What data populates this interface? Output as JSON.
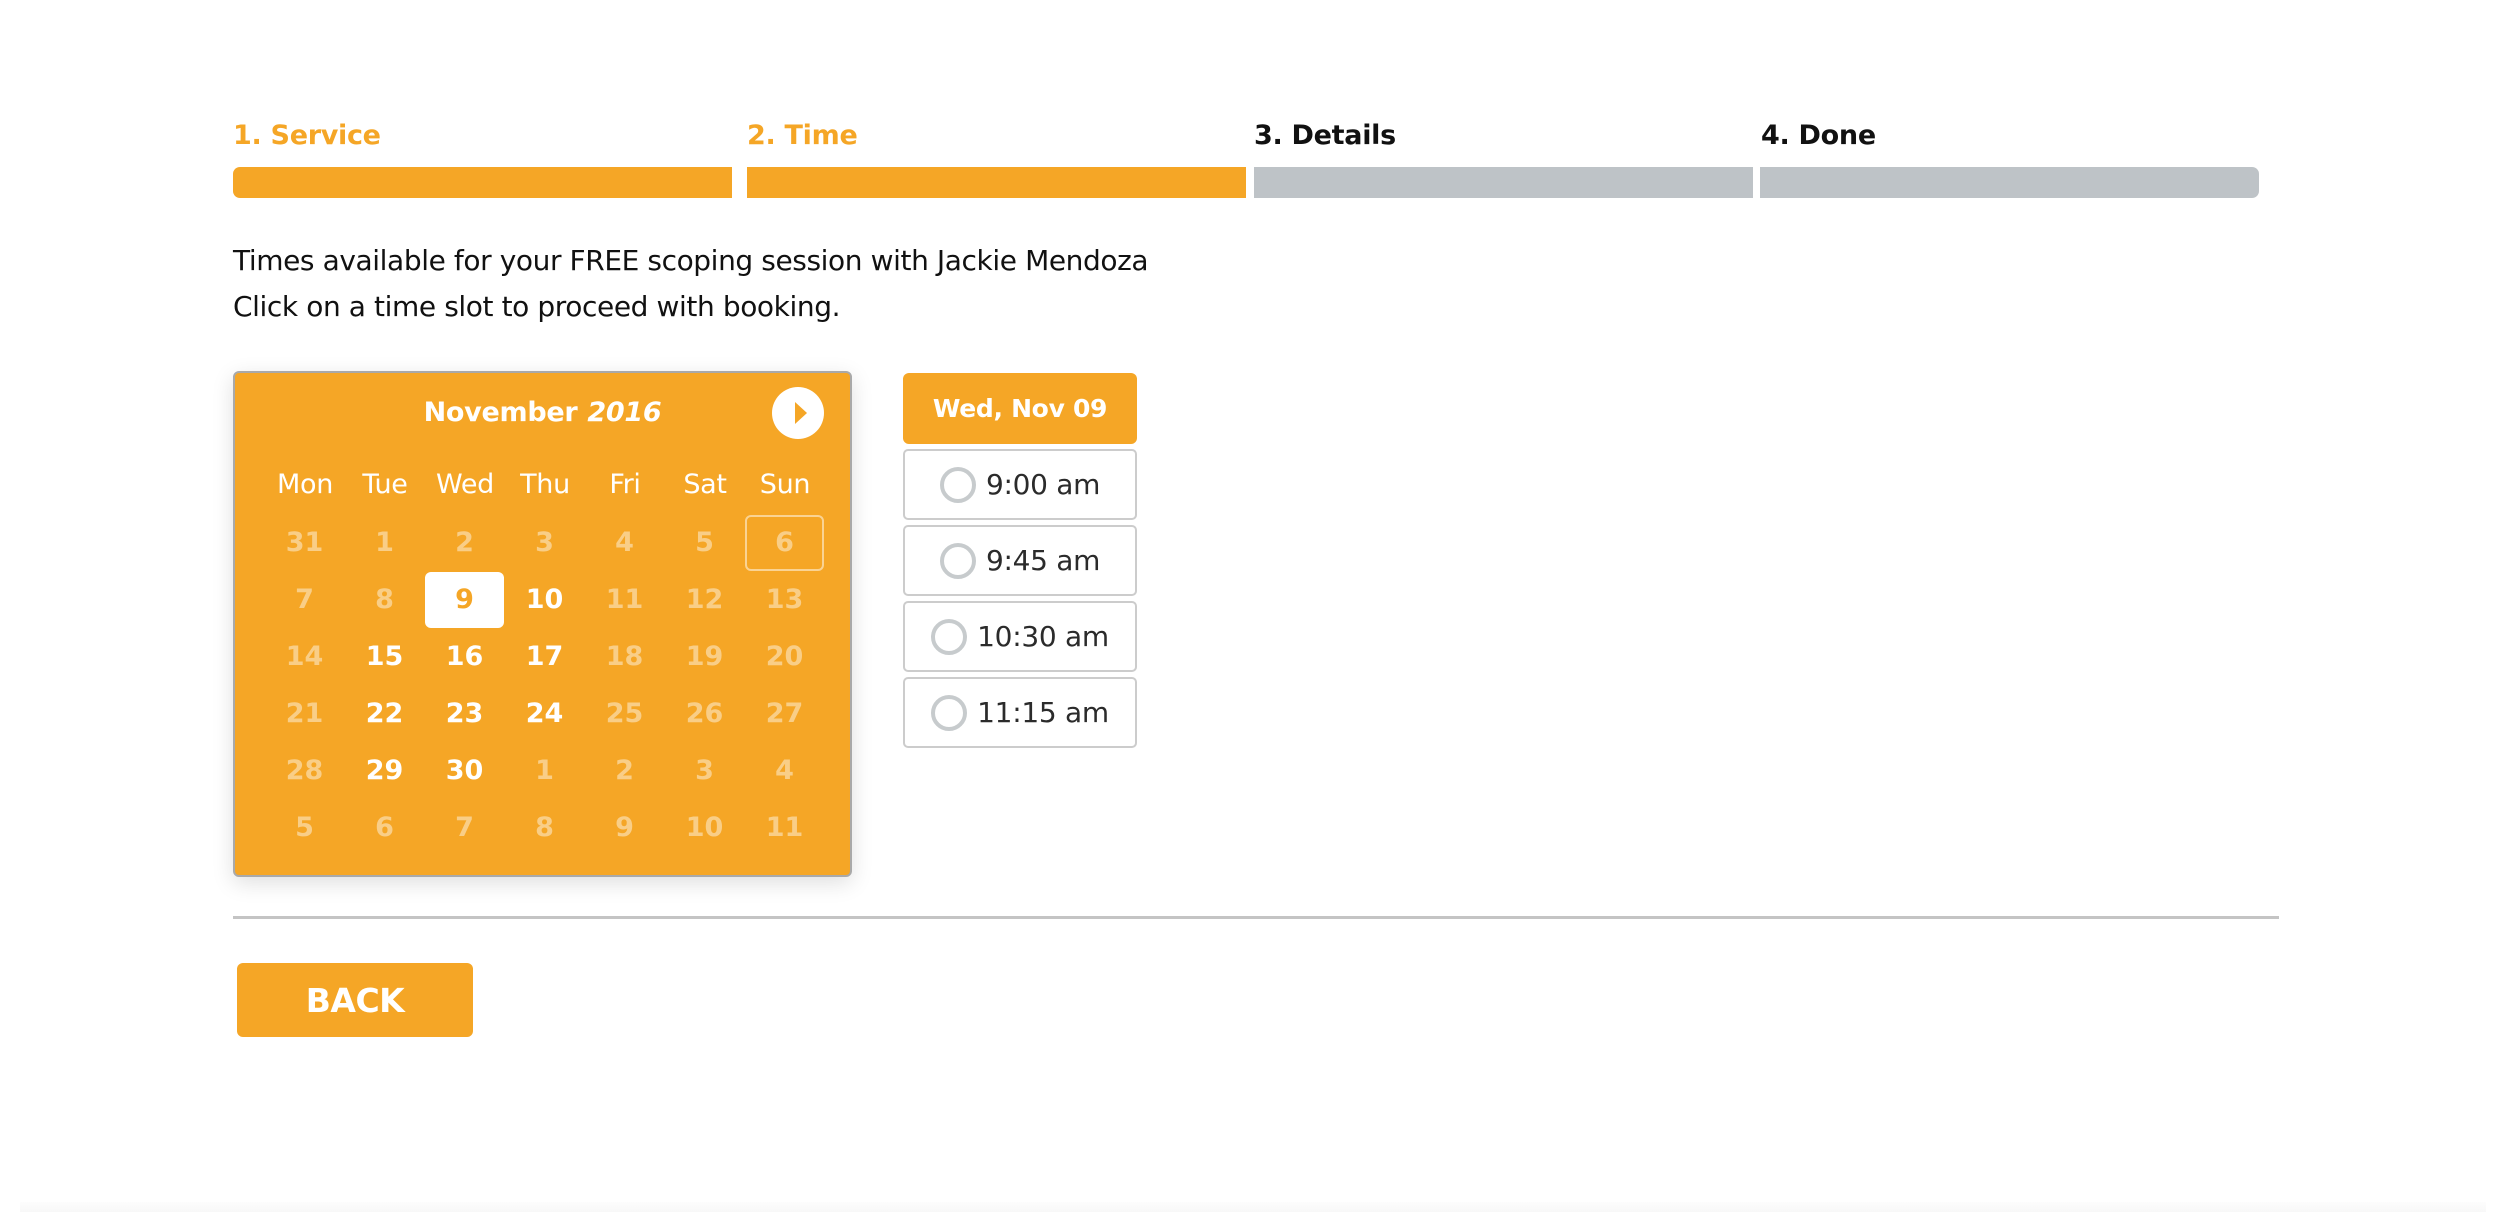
{
  "theme": {
    "accent": "#f5a626",
    "inactive_step": "#bec3c7",
    "text": "#111111"
  },
  "steps": [
    {
      "label": "1. Service",
      "state": "complete"
    },
    {
      "label": "2. Time",
      "state": "active"
    },
    {
      "label": "3. Details",
      "state": "pending"
    },
    {
      "label": "4. Done",
      "state": "pending"
    }
  ],
  "intro": {
    "line1": "Times available for your FREE scoping session with Jackie Mendoza",
    "line2": "Click on a time slot to proceed with booking."
  },
  "calendar": {
    "month": "November",
    "year": "2016",
    "next_icon": "chevron-right-circle-icon",
    "weekdays": [
      "Mon",
      "Tue",
      "Wed",
      "Thu",
      "Fri",
      "Sat",
      "Sun"
    ],
    "weeks": [
      [
        {
          "d": "31",
          "s": "disabled"
        },
        {
          "d": "1",
          "s": "disabled"
        },
        {
          "d": "2",
          "s": "disabled"
        },
        {
          "d": "3",
          "s": "disabled"
        },
        {
          "d": "4",
          "s": "disabled"
        },
        {
          "d": "5",
          "s": "disabled"
        },
        {
          "d": "6",
          "s": "today"
        }
      ],
      [
        {
          "d": "7",
          "s": "disabled"
        },
        {
          "d": "8",
          "s": "disabled"
        },
        {
          "d": "9",
          "s": "selected"
        },
        {
          "d": "10",
          "s": "available"
        },
        {
          "d": "11",
          "s": "disabled"
        },
        {
          "d": "12",
          "s": "disabled"
        },
        {
          "d": "13",
          "s": "disabled"
        }
      ],
      [
        {
          "d": "14",
          "s": "disabled"
        },
        {
          "d": "15",
          "s": "available"
        },
        {
          "d": "16",
          "s": "available"
        },
        {
          "d": "17",
          "s": "available"
        },
        {
          "d": "18",
          "s": "disabled"
        },
        {
          "d": "19",
          "s": "disabled"
        },
        {
          "d": "20",
          "s": "disabled"
        }
      ],
      [
        {
          "d": "21",
          "s": "disabled"
        },
        {
          "d": "22",
          "s": "available"
        },
        {
          "d": "23",
          "s": "available"
        },
        {
          "d": "24",
          "s": "available"
        },
        {
          "d": "25",
          "s": "disabled"
        },
        {
          "d": "26",
          "s": "disabled"
        },
        {
          "d": "27",
          "s": "disabled"
        }
      ],
      [
        {
          "d": "28",
          "s": "disabled"
        },
        {
          "d": "29",
          "s": "available"
        },
        {
          "d": "30",
          "s": "available"
        },
        {
          "d": "1",
          "s": "disabled"
        },
        {
          "d": "2",
          "s": "disabled"
        },
        {
          "d": "3",
          "s": "disabled"
        },
        {
          "d": "4",
          "s": "disabled"
        }
      ],
      [
        {
          "d": "5",
          "s": "disabled"
        },
        {
          "d": "6",
          "s": "disabled"
        },
        {
          "d": "7",
          "s": "disabled"
        },
        {
          "d": "8",
          "s": "disabled"
        },
        {
          "d": "9",
          "s": "disabled"
        },
        {
          "d": "10",
          "s": "disabled"
        },
        {
          "d": "11",
          "s": "disabled"
        }
      ]
    ]
  },
  "slots": {
    "header": "Wed, Nov 09",
    "times": [
      "9:00 am",
      "9:45 am",
      "10:30 am",
      "11:15 am"
    ]
  },
  "actions": {
    "back_label": "BACK"
  }
}
